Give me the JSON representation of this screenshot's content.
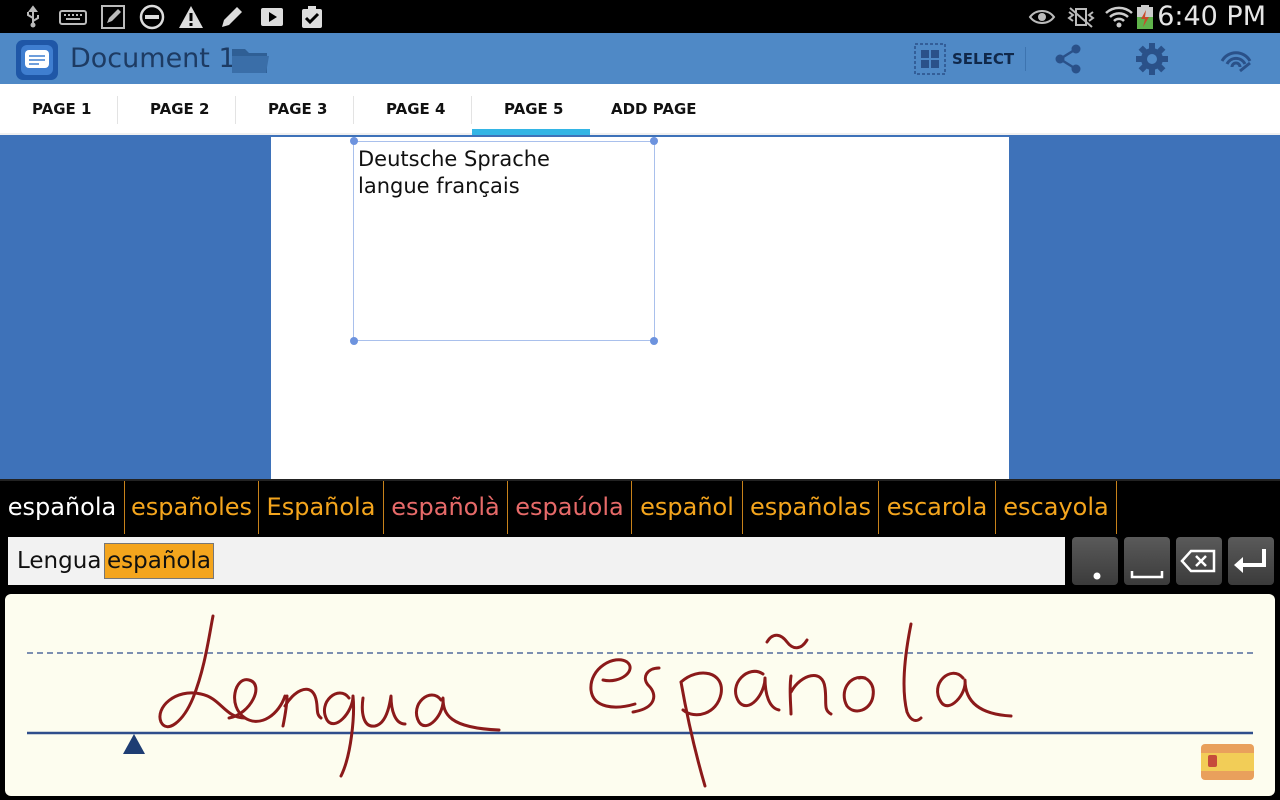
{
  "status_bar": {
    "time": "6:40 PM",
    "left_icons": [
      "usb-icon",
      "keyboard-icon",
      "pen-edit-icon",
      "do-not-disturb-icon",
      "warning-icon",
      "pencil-icon",
      "play-icon",
      "checkbox-icon"
    ],
    "right_icons": [
      "eye-icon",
      "vibrate-mute-icon",
      "wifi-icon",
      "battery-charging-icon"
    ]
  },
  "action_bar": {
    "title": "Document 1",
    "select_label": "SELECT",
    "icons": [
      "app-icon",
      "folder-icon",
      "grid-select-icon",
      "share-icon",
      "gear-icon",
      "signal-icon"
    ]
  },
  "tabs": [
    {
      "label": "PAGE 1",
      "active": false
    },
    {
      "label": "PAGE 2",
      "active": false
    },
    {
      "label": "PAGE 3",
      "active": false
    },
    {
      "label": "PAGE 4",
      "active": false
    },
    {
      "label": "PAGE 5",
      "active": true
    },
    {
      "label": "ADD PAGE",
      "active": false
    }
  ],
  "document": {
    "text_lines": [
      "Deutsche Sprache",
      "langue français"
    ]
  },
  "candidates": [
    {
      "label": "española",
      "color": "white"
    },
    {
      "label": "españoles",
      "color": "orange"
    },
    {
      "label": "Española",
      "color": "orange"
    },
    {
      "label": "españolà",
      "color": "red"
    },
    {
      "label": "espaúola",
      "color": "red"
    },
    {
      "label": "español",
      "color": "orange"
    },
    {
      "label": "españolas",
      "color": "orange"
    },
    {
      "label": "escarola",
      "color": "orange"
    },
    {
      "label": "escayola",
      "color": "orange"
    }
  ],
  "recognized": {
    "word1": "Lengua",
    "word2_selected": "española"
  },
  "keys": [
    "period-key",
    "space-key",
    "backspace-key",
    "enter-key"
  ],
  "handwriting_pad": {
    "language_flag": "spain-flag-icon"
  },
  "colors": {
    "action_bar": "#4f89c6",
    "tab_indicator": "#33b5e5",
    "canvas_bg": "#3e72b9",
    "candidate_orange": "#f4a51d",
    "candidate_red": "#e66a69",
    "ink": "#8b1a1a",
    "pad_bg": "#fdfdef"
  }
}
